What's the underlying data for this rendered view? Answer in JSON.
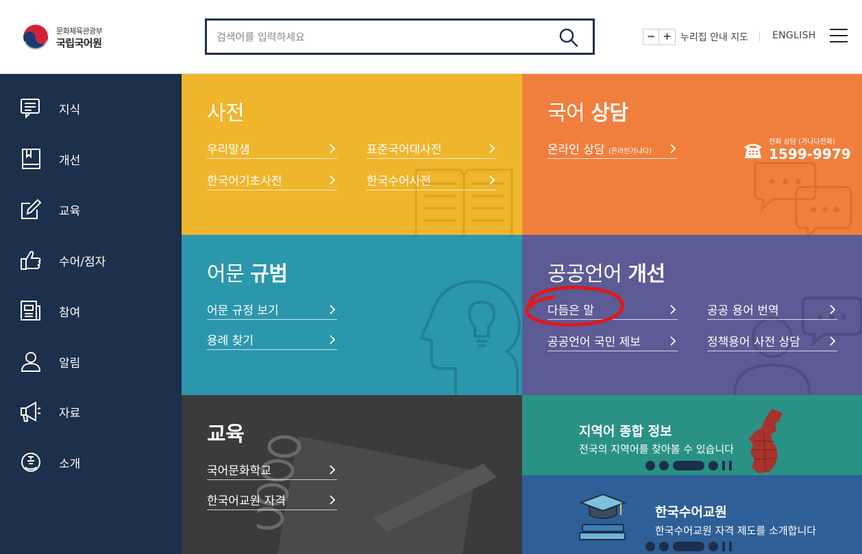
{
  "header": {
    "logo_sub": "문화체육관광부",
    "logo_main": "국립국어원",
    "search_placeholder": "검색어를 입력하세요",
    "zoom_out": "−",
    "zoom_in": "+",
    "sitemap": "누리집 안내 지도",
    "english": "ENGLISH"
  },
  "sidebar": {
    "items": [
      {
        "label": "지식",
        "icon": "chat-board-icon"
      },
      {
        "label": "개선",
        "icon": "book-icon"
      },
      {
        "label": "교육",
        "icon": "pencil-edit-icon"
      },
      {
        "label": "수어/점자",
        "icon": "thumbs-up-hand-icon"
      },
      {
        "label": "참여",
        "icon": "document-icon"
      },
      {
        "label": "알림",
        "icon": "user-icon"
      },
      {
        "label": "자료",
        "icon": "megaphone-icon"
      },
      {
        "label": "소개",
        "icon": "face-badge-icon"
      }
    ]
  },
  "tiles": {
    "dictionary": {
      "title": "사전",
      "links": [
        "우리말샘",
        "표준국어대사전",
        "한국어기초사전",
        "한국수어사전"
      ]
    },
    "consult": {
      "title_light": "국어 ",
      "title_bold": "상담",
      "link": "온라인 상담",
      "link_small": "(온라인가나다)",
      "phone_label": "전화 상담 (가나다전화)",
      "phone_number": "1599-9979"
    },
    "rules": {
      "title_light": "어문 ",
      "title_bold": "규범",
      "links": [
        "어문 규정 보기",
        "용례 찾기"
      ]
    },
    "public": {
      "title_light": "공공언어 ",
      "title_bold": "개선",
      "links": [
        "다듬은 말",
        "공공 용어 번역",
        "공공언어 국민 제보",
        "정책용어 사전 상담"
      ]
    },
    "education": {
      "title": "교육",
      "links": [
        "국어문화학교",
        "한국어교원 자격"
      ]
    },
    "regional": {
      "title": "지역어 종합 정보",
      "desc": "전국의 지역어를 찾아볼 수 있습니다"
    },
    "sign": {
      "title": "한국수어교원",
      "desc": "한국수어교원 자격 제도를 소개합니다"
    }
  },
  "colors": {
    "navy": "#1c2f4b",
    "yellow": "#efb52c",
    "orange": "#f07f3e",
    "teal": "#2b97ad",
    "purple": "#5c5b95",
    "dark": "#3b3b3b",
    "green": "#2a9285",
    "blue": "#2f5f97",
    "annotation_red": "#e01818"
  }
}
